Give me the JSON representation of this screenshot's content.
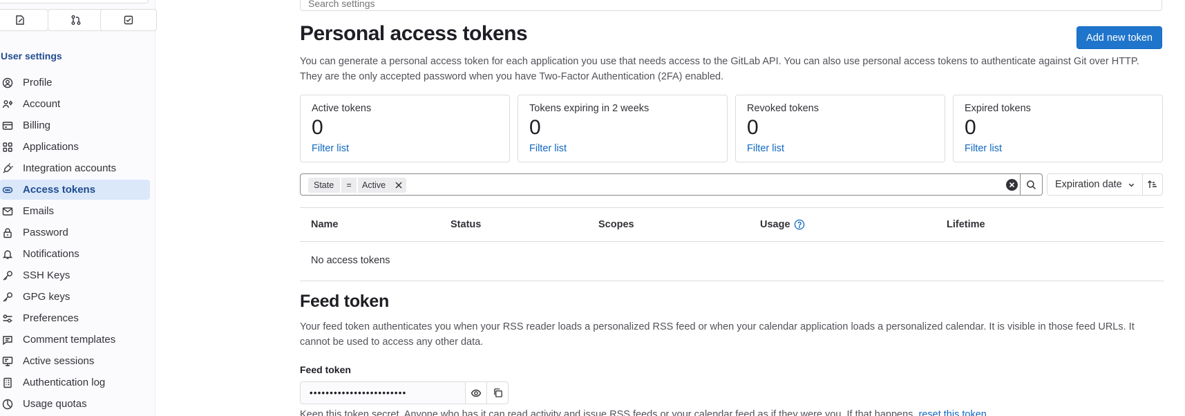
{
  "sidebar": {
    "section_title": "User settings",
    "items": [
      {
        "label": "Profile",
        "icon": "profile-icon"
      },
      {
        "label": "Account",
        "icon": "account-icon"
      },
      {
        "label": "Billing",
        "icon": "billing-icon"
      },
      {
        "label": "Applications",
        "icon": "applications-icon"
      },
      {
        "label": "Integration accounts",
        "icon": "integration-icon"
      },
      {
        "label": "Access tokens",
        "icon": "token-icon",
        "active": true
      },
      {
        "label": "Emails",
        "icon": "mail-icon"
      },
      {
        "label": "Password",
        "icon": "lock-icon"
      },
      {
        "label": "Notifications",
        "icon": "bell-icon"
      },
      {
        "label": "SSH Keys",
        "icon": "key-icon"
      },
      {
        "label": "GPG keys",
        "icon": "key-icon"
      },
      {
        "label": "Preferences",
        "icon": "preferences-icon"
      },
      {
        "label": "Comment templates",
        "icon": "comment-icon"
      },
      {
        "label": "Active sessions",
        "icon": "monitor-icon"
      },
      {
        "label": "Authentication log",
        "icon": "log-icon"
      },
      {
        "label": "Usage quotas",
        "icon": "quota-icon"
      }
    ]
  },
  "search": {
    "placeholder": "Search settings"
  },
  "page": {
    "title": "Personal access tokens",
    "add_button": "Add new token",
    "description": "You can generate a personal access token for each application you use that needs access to the GitLab API. You can also use personal access tokens to authenticate against Git over HTTP. They are the only accepted password when you have Two-Factor Authentication (2FA) enabled."
  },
  "stats": [
    {
      "label": "Active tokens",
      "count": "0",
      "link": "Filter list"
    },
    {
      "label": "Tokens expiring in 2 weeks",
      "count": "0",
      "link": "Filter list"
    },
    {
      "label": "Revoked tokens",
      "count": "0",
      "link": "Filter list"
    },
    {
      "label": "Expired tokens",
      "count": "0",
      "link": "Filter list"
    }
  ],
  "filter": {
    "token_field": "State",
    "operator": "=",
    "value": "Active",
    "sort_label": "Expiration date"
  },
  "table": {
    "columns": [
      "Name",
      "Status",
      "Scopes",
      "Usage",
      "Lifetime"
    ],
    "empty_text": "No access tokens"
  },
  "feed": {
    "title": "Feed token",
    "description": "Your feed token authenticates you when your RSS reader loads a personalized RSS feed or when your calendar application loads a personalized calendar. It is visible in those feed URLs. It cannot be used to access any other data.",
    "field_label": "Feed token",
    "masked_value": "••••••••••••••••••••••••",
    "help_text": "Keep this token secret. Anyone who has it can read activity and issue RSS feeds or your calendar feed as if they were you. If that happens, ",
    "help_link": "reset this token"
  },
  "colors": {
    "accent": "#1f75cb",
    "link": "#1068bf",
    "active_bg": "#dbe8fa"
  }
}
